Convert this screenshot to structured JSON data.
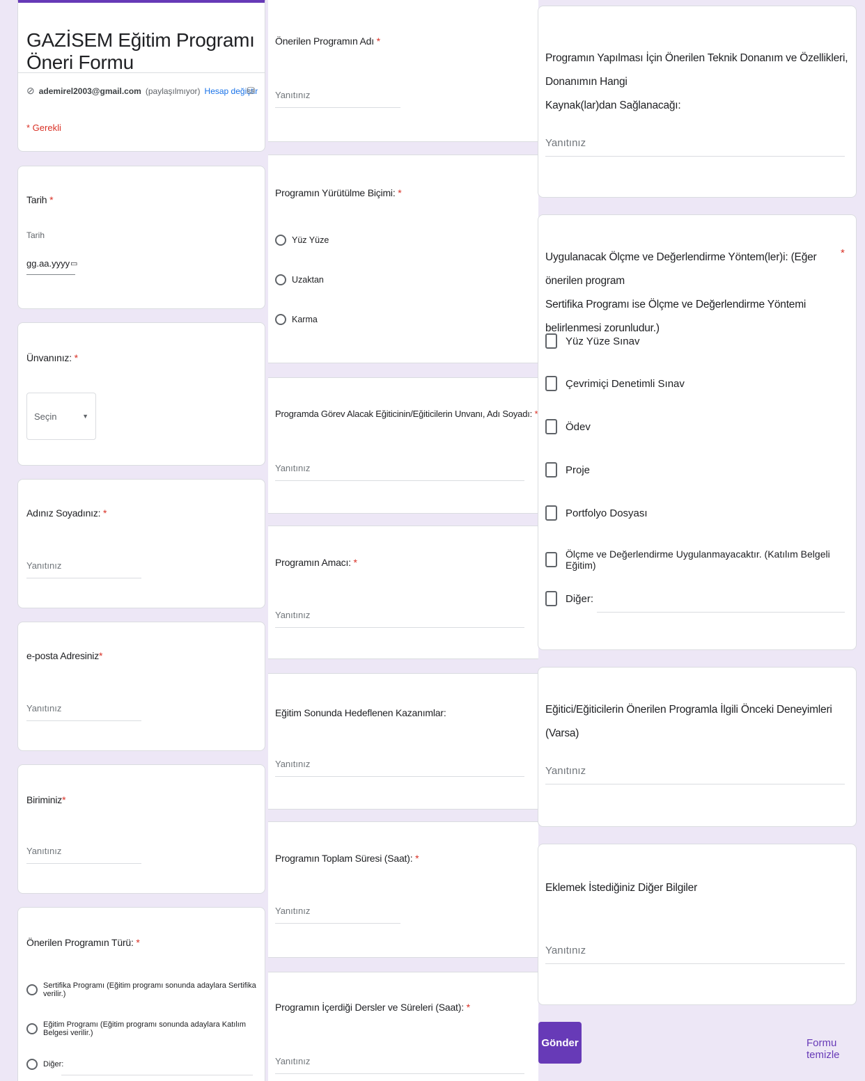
{
  "form": {
    "title": "GAZİSEM Eğitim Programı Öneri Formu",
    "account_email": "ademirel2003@gmail.com",
    "account_note": "(paylaşılmıyor)",
    "switch_account": "Hesap değiştir",
    "required_note": "* Gerekli",
    "accent_color": "#673ab7"
  },
  "common": {
    "star": "*",
    "answer_placeholder": "Yanıtınız",
    "other_label": "Diğer:"
  },
  "q_date": {
    "label": "Tarih",
    "sub_label": "Tarih",
    "value": "gg.aa.yyyy"
  },
  "q_title": {
    "label": "Ünvanınız:",
    "select_value": "Seçin"
  },
  "q_name": {
    "label": "Adınız Soyadınız:"
  },
  "q_email": {
    "label": "e-posta Adresiniz"
  },
  "q_unit": {
    "label": "Biriminiz"
  },
  "q_type": {
    "label": "Önerilen Programın Türü:",
    "options": [
      "Sertifika Programı (Eğitim programı sonunda adaylara Sertifika verilir.)",
      "Eğitim Programı  (Eğitim programı sonunda adaylara Katılım Belgesi verilir.)",
      "Diğer:"
    ]
  },
  "q_prog_name": {
    "label": "Önerilen Programın Adı"
  },
  "q_format": {
    "label": "Programın Yürütülme Biçimi:",
    "options": [
      "Yüz Yüze",
      "Uzaktan",
      "Karma"
    ]
  },
  "q_trainers": {
    "label": "Programda Görev Alacak Eğiticinin/Eğiticilerin Unvanı, Adı Soyadı:"
  },
  "q_purpose": {
    "label": "Programın Amacı:"
  },
  "q_outcomes": {
    "label": "Eğitim Sonunda Hedeflenen Kazanımlar:"
  },
  "q_duration": {
    "label": "Programın Toplam Süresi (Saat):"
  },
  "q_courses": {
    "label": "Programın İçerdiği Dersler ve Süreleri (Saat):"
  },
  "q_equipment": {
    "label_line1": "Programın Yapılması İçin Önerilen Teknik Donanım ve Özellikleri, Donanımın Hangi",
    "label_line2": "Kaynak(lar)dan Sağlanacağı:"
  },
  "q_assessment": {
    "label_line1": "Uygulanacak Ölçme ve Değerlendirme Yöntem(ler)i: (Eğer önerilen program",
    "label_line2": "Sertifika Programı ise Ölçme ve Değerlendirme Yöntemi belirlenmesi zorunludur.)",
    "options": [
      "Yüz Yüze Sınav",
      "Çevrimiçi Denetimli Sınav",
      "Ödev",
      "Proje",
      "Portfolyo Dosyası",
      "Ölçme ve Değerlendirme Uygulanmayacaktır. (Katılım Belgeli Eğitim)",
      "Diğer:"
    ]
  },
  "q_experience": {
    "label": "Eğitici/Eğiticilerin Önerilen Programla İlgili Önceki Deneyimleri (Varsa)"
  },
  "q_other_info": {
    "label": "Eklemek İstediğiniz Diğer Bilgiler"
  },
  "actions": {
    "submit": "Gönder",
    "clear": "Formu temizle"
  }
}
